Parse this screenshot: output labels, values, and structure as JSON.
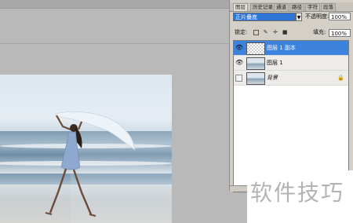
{
  "panel": {
    "tabs": [
      "图层",
      "历史记录",
      "通道",
      "路径",
      "字符",
      "段落"
    ],
    "blend_mode": "正片叠底",
    "opacity_label": "不透明度:",
    "opacity_value": "100%",
    "lock_label": "锁定:",
    "fill_label": "填充:",
    "fill_value": "100%",
    "lock_icons": [
      "lock-transparent-icon",
      "lock-brush-icon",
      "lock-move-icon",
      "lock-all-icon"
    ],
    "layers": [
      {
        "name": "图层 1 副本",
        "visible": true,
        "selected": true
      },
      {
        "name": "图层 1",
        "visible": true,
        "selected": false
      },
      {
        "name": "背景",
        "visible": false,
        "selected": false,
        "locked": true
      }
    ]
  },
  "watermark": {
    "text": "软件技巧"
  }
}
